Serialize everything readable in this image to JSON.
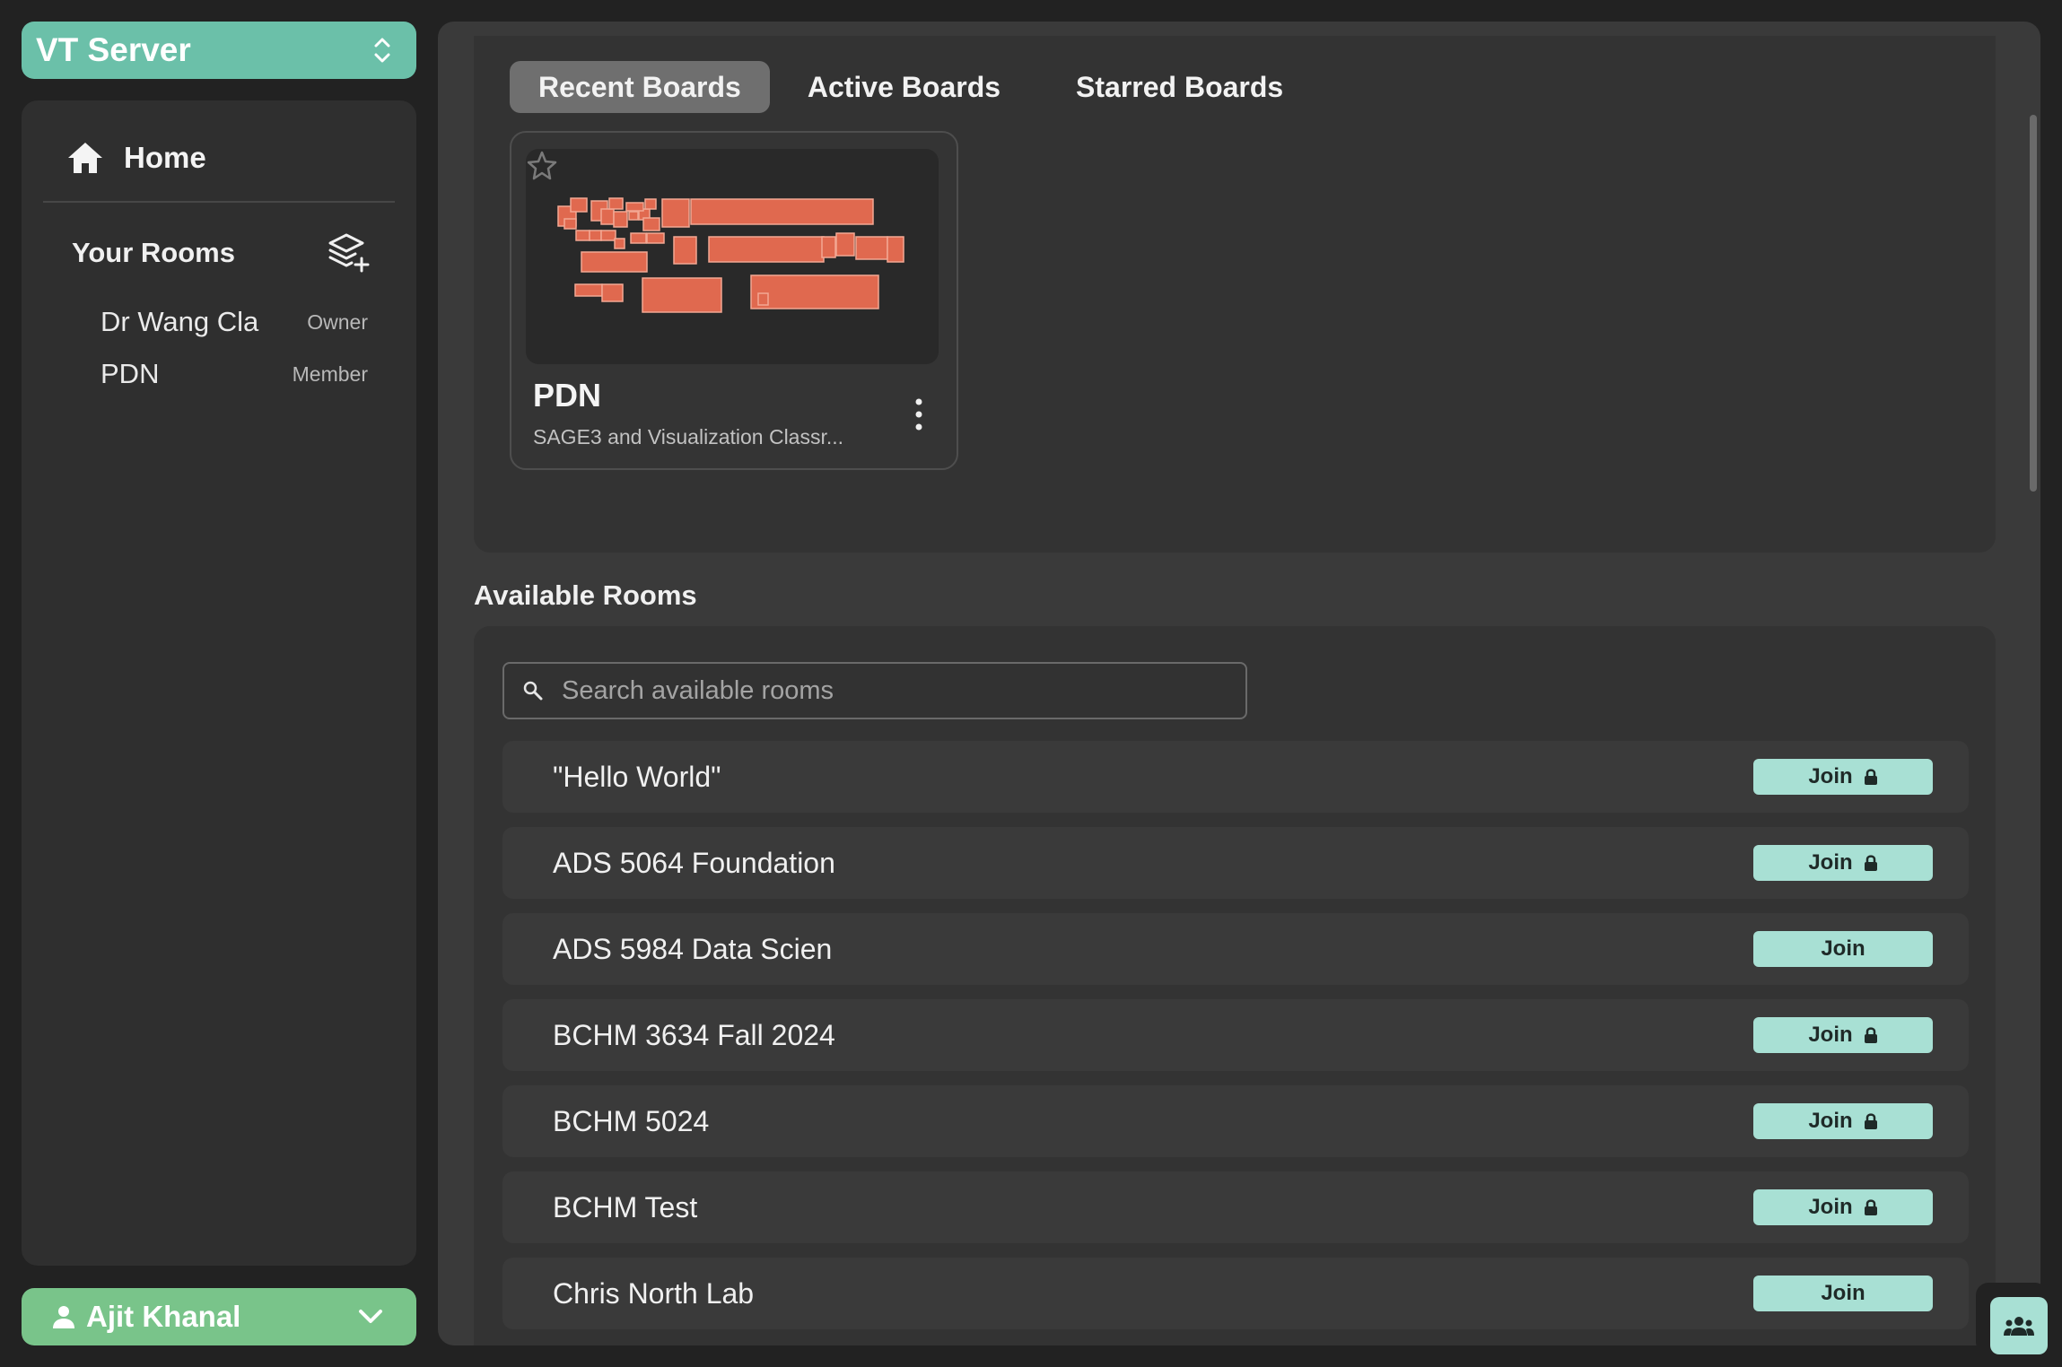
{
  "server": {
    "name": "VT Server"
  },
  "sidebar": {
    "home_label": "Home",
    "rooms_title": "Your Rooms",
    "rooms": [
      {
        "name": "Dr Wang Cla",
        "role": "Owner"
      },
      {
        "name": "PDN",
        "role": "Member"
      }
    ]
  },
  "user": {
    "name": "Ajit Khanal"
  },
  "tabs": [
    "Recent Boards",
    "Active Boards",
    "Starred Boards"
  ],
  "board": {
    "name": "PDN",
    "description": "SAGE3 and Visualization Classr..."
  },
  "available": {
    "title": "Available Rooms",
    "search_placeholder": "Search available rooms",
    "join_label": "Join",
    "rooms": [
      {
        "name": "\"Hello World\"",
        "locked": true
      },
      {
        "name": "ADS 5064 Foundation",
        "locked": true
      },
      {
        "name": "ADS 5984 Data Scien",
        "locked": false
      },
      {
        "name": "BCHM 3634 Fall 2024",
        "locked": true
      },
      {
        "name": "BCHM 5024",
        "locked": true
      },
      {
        "name": "BCHM Test",
        "locked": true
      },
      {
        "name": "Chris North Lab",
        "locked": false
      }
    ]
  },
  "colors": {
    "server_button": "#6bc0a9",
    "user_button": "#79c48a",
    "join_button": "#a8e0d4",
    "board_app": "#e0694f"
  },
  "icons": {
    "server_toggle": "chevron-up-down-icon",
    "home": "home-icon",
    "add_room": "layers-plus-icon",
    "user": "person-icon",
    "user_menu": "chevron-down-icon",
    "star": "star-icon",
    "board_menu": "kebab-menu-icon",
    "search": "search-icon",
    "lock": "lock-icon",
    "people": "people-icon"
  }
}
